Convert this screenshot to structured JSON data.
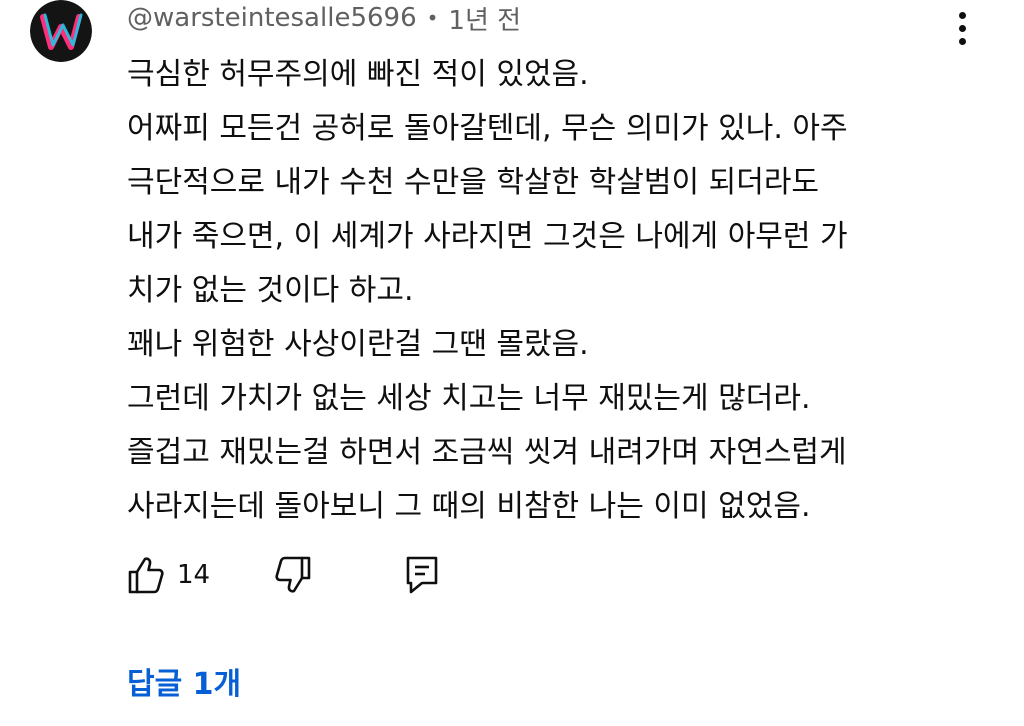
{
  "comment": {
    "author": "@warsteintesalle5696",
    "separator": "•",
    "timestamp": "1년 전",
    "avatar_icon": "w-logo-avatar",
    "lines": [
      "극심한 허무주의에 빠진 적이 있었음.",
      "어짜피 모든건 공허로 돌아갈텐데, 무슨 의미가 있나. 아주",
      "극단적으로 내가 수천 수만을 학살한 학살범이 되더라도",
      "내가 죽으면, 이 세계가 사라지면 그것은 나에게 아무런 가",
      "치가 없는 것이다 하고.",
      "꽤나 위험한 사상이란걸 그땐 몰랐음.",
      "그런데 가치가 없는 세상 치고는 너무 재밌는게 많더라.",
      "즐겁고 재밌는걸 하면서 조금씩 씻겨 내려가며 자연스럽게",
      "사라지는데 돌아보니 그 때의 비참한 나는 이미 없었음."
    ],
    "like_count": "14",
    "replies_label": "답글 1개"
  },
  "icons": {
    "like": "thumbs-up-icon",
    "dislike": "thumbs-down-icon",
    "reply": "comment-icon",
    "more": "more-vertical-icon"
  },
  "colors": {
    "text": "#0f0f0f",
    "secondary": "#606060",
    "link": "#065fd4",
    "avatar_bg": "#141414",
    "avatar_pink": "#ff2d7a",
    "avatar_cyan": "#19c9e6"
  }
}
